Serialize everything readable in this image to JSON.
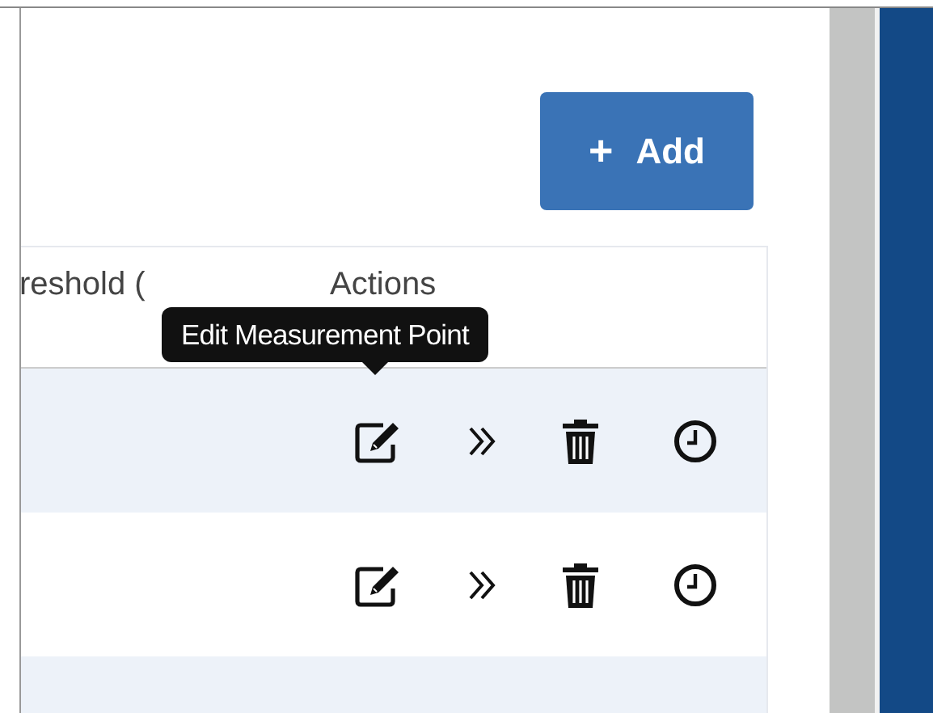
{
  "add_button": {
    "icon": "+",
    "label": "Add"
  },
  "table": {
    "columns": [
      {
        "label": "reshold ("
      },
      {
        "label": "Actions"
      }
    ],
    "rows": [
      {
        "kind": "actions"
      },
      {
        "kind": "actions"
      },
      {
        "kind": "blank"
      }
    ]
  },
  "tooltip": {
    "text": "Edit Measurement Point"
  }
}
